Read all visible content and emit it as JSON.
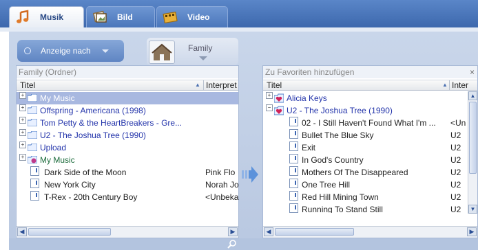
{
  "tabs": [
    {
      "label": "Musik",
      "icon": "music-note-icon",
      "active": true
    },
    {
      "label": "Bild",
      "icon": "image-icon",
      "active": false
    },
    {
      "label": "Video",
      "icon": "film-icon",
      "active": false
    }
  ],
  "view_selector": {
    "label": "Anzeige nach"
  },
  "profile": {
    "label": "Family"
  },
  "left_panel": {
    "title": "Family (Ordner)",
    "columns": [
      "Titel",
      "Interpret"
    ],
    "rows": [
      {
        "title": "My Music",
        "artist": "",
        "kind": "folder",
        "selected": true
      },
      {
        "title": "Offspring - Americana (1998)",
        "artist": "",
        "kind": "folder"
      },
      {
        "title": "Tom Petty & the HeartBreakers - Gre...",
        "artist": "",
        "kind": "folder"
      },
      {
        "title": "U2 - The Joshua Tree (1990)",
        "artist": "",
        "kind": "folder"
      },
      {
        "title": "Upload",
        "artist": "",
        "kind": "folder"
      },
      {
        "title": "My Music",
        "artist": "",
        "kind": "shared-folder"
      },
      {
        "title": "Dark Side of the Moon",
        "artist": "Pink Flo",
        "kind": "track"
      },
      {
        "title": "New York City",
        "artist": "Norah Jo",
        "kind": "track"
      },
      {
        "title": "T-Rex - 20th Century Boy",
        "artist": "<Unbeka",
        "kind": "track"
      }
    ]
  },
  "right_panel": {
    "title": "Zu Favoriten hinzufügen",
    "close": "×",
    "columns": [
      "Titel",
      "Inter"
    ],
    "rows": [
      {
        "title": "Alicia Keys",
        "artist": "",
        "kind": "favorite-folder",
        "expanded": false
      },
      {
        "title": "U2 - The Joshua Tree (1990)",
        "artist": "",
        "kind": "favorite-folder",
        "expanded": true
      },
      {
        "title": "02 - I Still Haven't Found What I'm ...",
        "artist": "<Un",
        "kind": "track"
      },
      {
        "title": "Bullet The Blue Sky",
        "artist": "U2",
        "kind": "track"
      },
      {
        "title": "Exit",
        "artist": "U2",
        "kind": "track"
      },
      {
        "title": "In God's Country",
        "artist": "U2",
        "kind": "track"
      },
      {
        "title": "Mothers Of The Disappeared",
        "artist": "U2",
        "kind": "track"
      },
      {
        "title": "One Tree Hill",
        "artist": "U2",
        "kind": "track"
      },
      {
        "title": "Red Hill Mining Town",
        "artist": "U2",
        "kind": "track"
      },
      {
        "title": "Running To Stand Still",
        "artist": "U2",
        "kind": "track"
      }
    ]
  },
  "colors": {
    "accent": "#3d68ad",
    "link": "#2233aa",
    "selected": "#a8b8e0"
  }
}
